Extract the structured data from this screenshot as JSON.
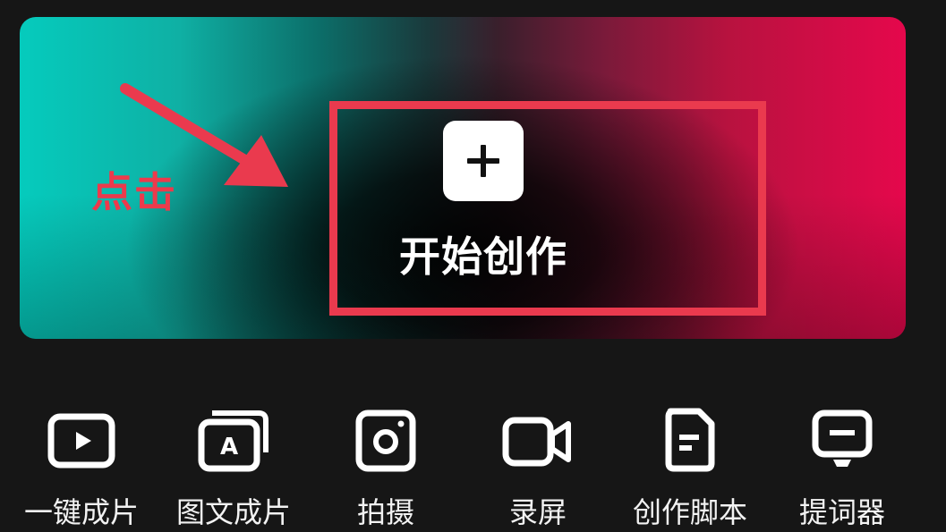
{
  "banner": {
    "annotation_text": "点击",
    "start_label": "开始创作"
  },
  "tools": [
    {
      "label": "一键成片",
      "icon": "play-video-icon"
    },
    {
      "label": "图文成片",
      "icon": "text-to-video-icon"
    },
    {
      "label": "拍摄",
      "icon": "camera-icon"
    },
    {
      "label": "录屏",
      "icon": "screen-record-icon"
    },
    {
      "label": "创作脚本",
      "icon": "script-document-icon"
    },
    {
      "label": "提词器",
      "icon": "teleprompter-icon"
    }
  ],
  "colors": {
    "annotation_red": "#ea3a4e",
    "banner_teal": "#05cbbd",
    "banner_pink": "#e5084c",
    "background": "#161616"
  }
}
